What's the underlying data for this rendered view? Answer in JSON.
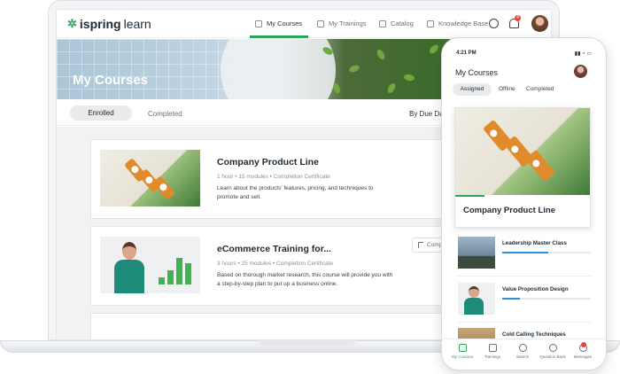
{
  "app": {
    "logo_brand": "ispring",
    "logo_product": "learn"
  },
  "nav": {
    "tabs": [
      {
        "label": "My Courses",
        "icon": "book-icon",
        "active": true
      },
      {
        "label": "My Trainings",
        "icon": "calendar-icon",
        "active": false
      },
      {
        "label": "Catalog",
        "icon": "bag-icon",
        "active": false
      },
      {
        "label": "Knowledge Base",
        "icon": "document-icon",
        "active": false
      }
    ],
    "notification_count": "4"
  },
  "hero": {
    "title": "My Courses"
  },
  "filters": {
    "tab_enrolled": "Enrolled",
    "tab_completed": "Completed",
    "sort_label": "By Due Da"
  },
  "courses": [
    {
      "title": "Company Product Line",
      "meta": "1 hour • 15 modules  •  Completion Certificate",
      "description": "Learn about the products' features, pricing, and techniques to promote and sell."
    },
    {
      "title": "eCommerce Training for...",
      "meta": "3 hours • 25 modules  •  Completion Certificate",
      "description": "Based on thorough market research, this course will provide you with a step-by-step plan to put up a business online.",
      "action": "Comp"
    }
  ],
  "phone": {
    "status_time": "4:21 PM",
    "status_right": "▮▮ ◔ ▭",
    "title": "My Courses",
    "tabs": [
      "Assigned",
      "Offline",
      "Completed"
    ],
    "featured": {
      "title": "Company Product Line",
      "progress": 0.22
    },
    "items": [
      {
        "title": "Leadership Master Class",
        "progress": 0.52
      },
      {
        "title": "Value Proposition Design",
        "progress": 0.2
      },
      {
        "title": "Cold Calling Techniques",
        "progress": 0
      }
    ],
    "bottom_nav": [
      "My Courses",
      "Trainings",
      "Search",
      "Question Bank",
      "Messages"
    ]
  },
  "colors": {
    "accent": "#2fa35a",
    "progress_blue": "#2f8fe0",
    "badge": "#e8453c"
  }
}
